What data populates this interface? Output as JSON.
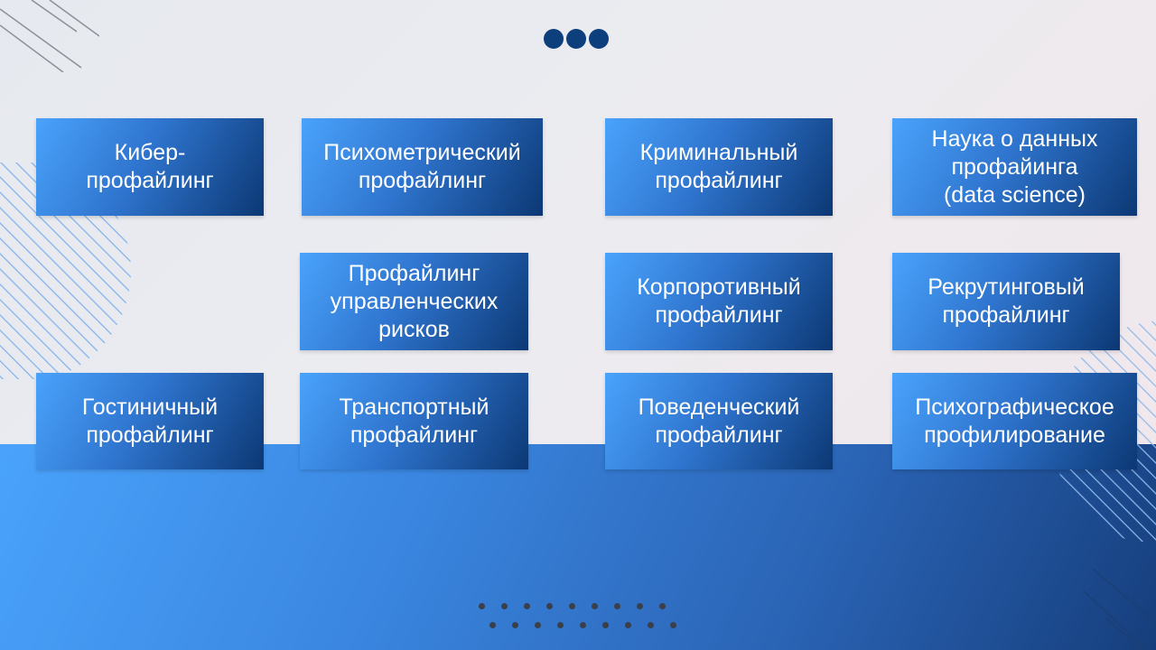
{
  "slide": {
    "accent_color": "#0d3f7c",
    "band_color": "#4aa3fb",
    "cards": [
      {
        "label": "Кибер-\nпрофайлинг"
      },
      {
        "label": "Психометрический\nпрофайлинг"
      },
      {
        "label": "Криминальный\nпрофайлинг"
      },
      {
        "label": "Наука о данных\nпрофайинга\n(data science)"
      },
      {
        "label": "Профайлинг\nуправленческих\nрисков"
      },
      {
        "label": "Корпоротивный\nпрофайлинг"
      },
      {
        "label": "Рекрутинговый\nпрофайлинг"
      },
      {
        "label": "Гостиничный\nпрофайлинг"
      },
      {
        "label": "Транспортный\nпрофайлинг"
      },
      {
        "label": "Поведенческий\nпрофайлинг"
      },
      {
        "label": "Психографическое\nпрофилирование"
      }
    ]
  }
}
